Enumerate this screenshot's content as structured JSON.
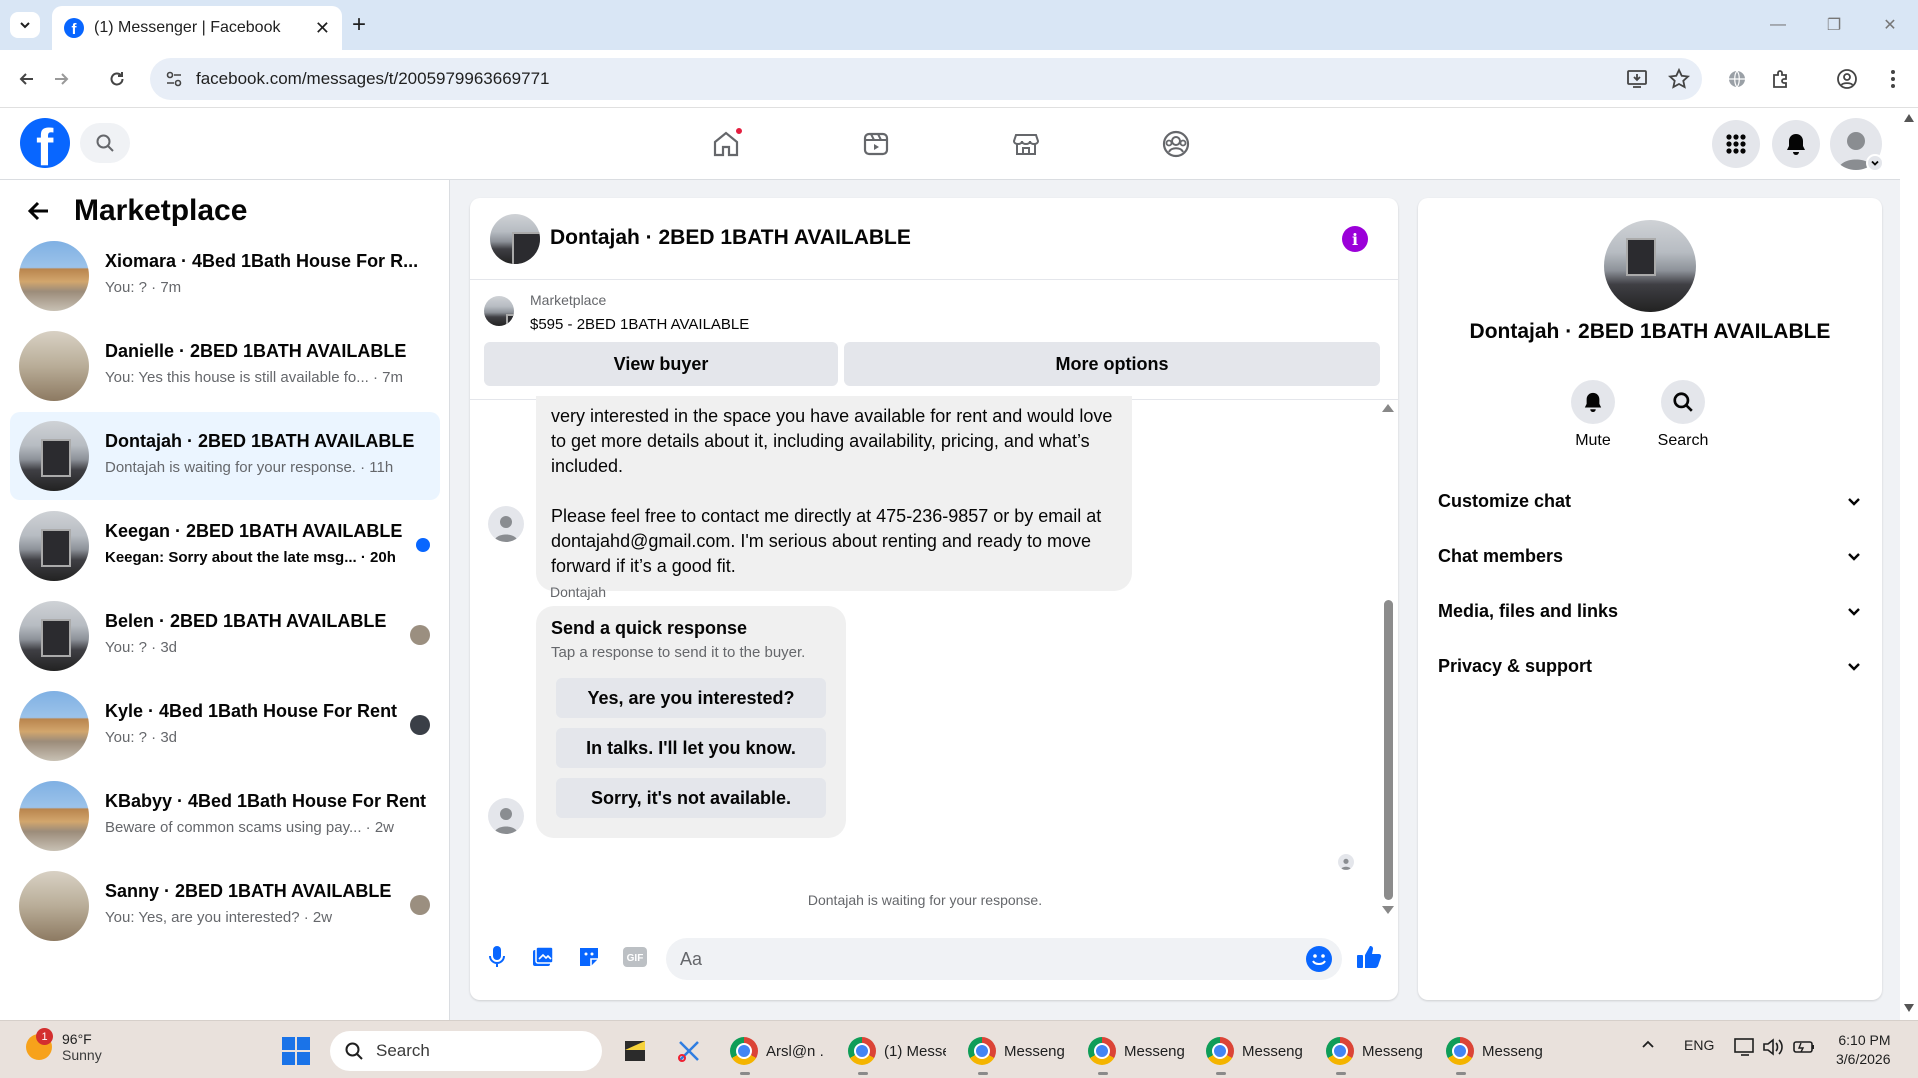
{
  "browser": {
    "tab_title": "(1) Messenger | Facebook",
    "url": "facebook.com/messages/t/2005979963669771"
  },
  "sidebar": {
    "title": "Marketplace",
    "conversations": [
      {
        "name": "Xiomara · 4Bed 1Bath House For R...",
        "snippet": "You: ? · 7m",
        "thumb": "house",
        "status": "none"
      },
      {
        "name": "Danielle · 2BED 1BATH AVAILABLE",
        "snippet": "You: Yes this house is still available fo...  · 7m",
        "thumb": "room",
        "status": "none"
      },
      {
        "name": "Dontajah · 2BED 1BATH AVAILABLE",
        "snippet": "Dontajah is waiting for your response. · 11h",
        "thumb": "kitchen",
        "status": "none",
        "active": true
      },
      {
        "name": "Keegan · 2BED 1BATH AVAILABLE",
        "snippet": "Keegan: Sorry about the late msg... · 20h",
        "thumb": "kitchen",
        "status": "unread"
      },
      {
        "name": "Belen · 2BED 1BATH AVAILABLE",
        "snippet": "You: ? · 3d",
        "thumb": "kitchen",
        "status": "seen"
      },
      {
        "name": "Kyle · 4Bed 1Bath House For Rent",
        "snippet": "You: ? · 3d",
        "thumb": "house",
        "status": "seen"
      },
      {
        "name": "KBabyy · 4Bed 1Bath House For Rent",
        "snippet": "Beware of common scams using pay...  · 2w",
        "thumb": "house",
        "status": "none"
      },
      {
        "name": "Sanny · 2BED 1BATH AVAILABLE",
        "snippet": "You: Yes, are you interested? · 2w",
        "thumb": "room",
        "status": "seen"
      }
    ]
  },
  "chat": {
    "title": "Dontajah · 2BED 1BATH AVAILABLE",
    "listing_source": "Marketplace",
    "listing_price": "$595 - 2BED 1BATH AVAILABLE",
    "view_buyer": "View buyer",
    "more_options": "More options",
    "message_para1": "very interested in the space you have available for rent and would love to get more details about it, including availability, pricing, and what’s included.",
    "message_para2": "Please feel free to contact me directly at 475-236-9857 or by email at dontajahd@gmail.com. I'm serious about renting and ready to move forward if it’s a good fit.",
    "sender": "Dontajah",
    "quick_title": "Send a quick response",
    "quick_subtitle": "Tap a response to send it to the buyer.",
    "quick_replies": [
      "Yes, are you interested?",
      "In talks. I'll let you know.",
      "Sorry, it's not available."
    ],
    "waiting": "Dontajah is waiting for your response.",
    "composer_placeholder": "Aa"
  },
  "info": {
    "name": "Dontajah · 2BED 1BATH AVAILABLE",
    "mute": "Mute",
    "search": "Search",
    "sections": [
      "Customize chat",
      "Chat members",
      "Media, files and links",
      "Privacy & support"
    ]
  },
  "taskbar": {
    "temp": "96°F",
    "condition": "Sunny",
    "weather_badge": "1",
    "search": "Search",
    "apps": [
      "Arsl@n .",
      "(1) Messe",
      "Messeng",
      "Messeng",
      "Messeng",
      "Messeng",
      "Messeng"
    ],
    "lang": "ENG",
    "time": "6:10 PM",
    "date": "3/6/2026"
  },
  "colors": {
    "facebook_blue": "#0866ff",
    "active_conversation": "#ebf5ff",
    "info_purple": "#9b00d9"
  }
}
